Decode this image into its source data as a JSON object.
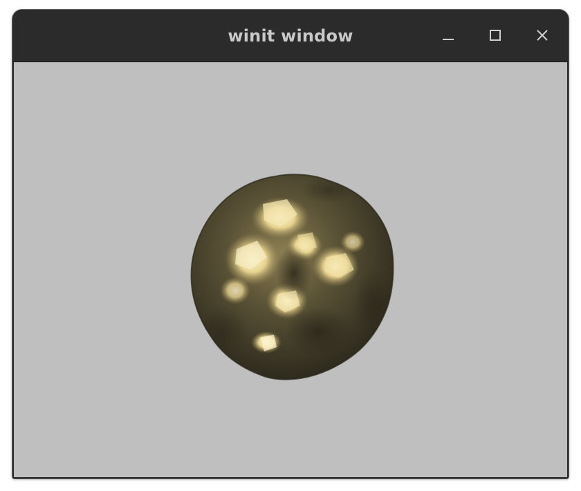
{
  "window": {
    "title": "winit window",
    "controls": {
      "minimize_icon": "minimize-icon",
      "maximize_icon": "maximize-icon",
      "close_icon": "close-icon"
    }
  },
  "colors": {
    "titlebar": "#2b2b2b",
    "title_text": "#c9c9c9",
    "canvas_background": "#bfbfbf",
    "object_dark": "#3a3524",
    "object_highlight": "#f6ecbd"
  }
}
